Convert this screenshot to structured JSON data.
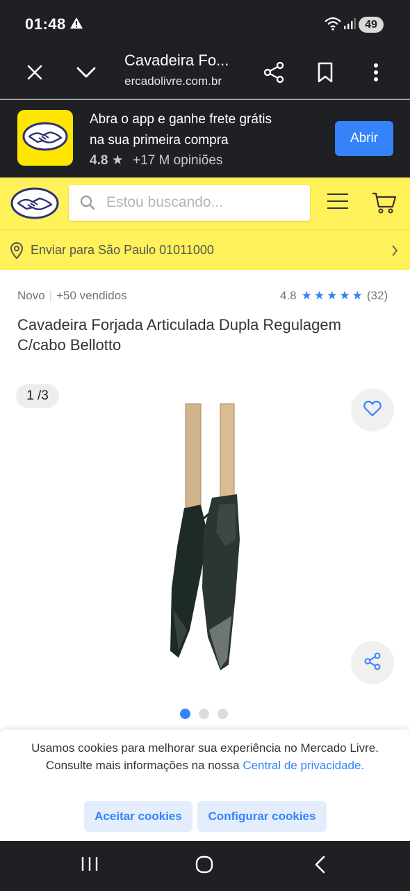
{
  "status_bar": {
    "time": "01:48",
    "battery": "49"
  },
  "browser": {
    "tab_title": "Cavadeira Fo...",
    "url": "mercadolivre.com.br"
  },
  "app_banner": {
    "line1": "Abra o app e ganhe frete grátis",
    "line2": "na sua primeira compra",
    "rating": "4.8",
    "opinions": "+17 M opiniões",
    "open_label": "Abrir"
  },
  "header": {
    "search_placeholder": "Estou buscando..."
  },
  "delivery": {
    "text": "Enviar para São Paulo 01011000"
  },
  "product": {
    "condition": "Novo",
    "sold": "+50 vendidos",
    "rating": "4.8",
    "reviews": "(32)",
    "title": "Cavadeira Forjada Articulada Dupla Regulagem C/cabo Bellotto",
    "image_counter": "1 /3",
    "image_count": 3,
    "active_image": 1
  },
  "cookies": {
    "text": "Usamos cookies para melhorar sua experiência no Mercado Livre. Consulte mais informações na nossa",
    "link": "Central de privacidade.",
    "accept_label": "Aceitar cookies",
    "configure_label": "Configurar cookies"
  },
  "colors": {
    "brand_yellow": "#fff159",
    "accent_blue": "#3483fa",
    "dark_bar": "#1f2023"
  }
}
